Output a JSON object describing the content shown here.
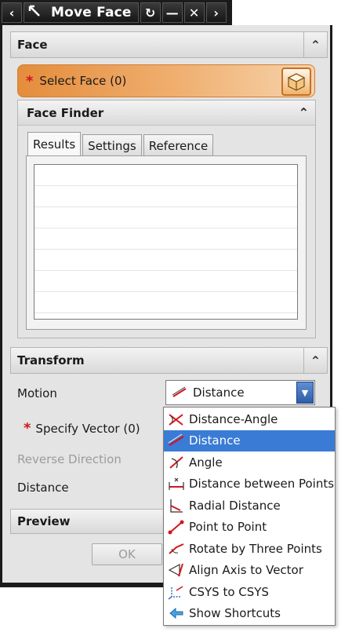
{
  "window": {
    "title": "Move Face"
  },
  "sections": {
    "face": {
      "label": "Face"
    },
    "transform": {
      "label": "Transform"
    },
    "preview": {
      "label": "Preview"
    }
  },
  "select_face": {
    "label": "Select Face (0)",
    "required_mark": "*"
  },
  "face_finder": {
    "label": "Face Finder",
    "tabs": [
      "Results",
      "Settings",
      "Reference"
    ],
    "active_tab": "Results"
  },
  "transform": {
    "motion_label": "Motion",
    "motion_value": "Distance",
    "specify_vector_label": "Specify Vector (0)",
    "required_mark": "*",
    "reverse_direction_label": "Reverse Direction",
    "distance_label": "Distance"
  },
  "motion_options": [
    {
      "label": "Distance-Angle",
      "icon": "distance-angle-icon"
    },
    {
      "label": "Distance",
      "icon": "distance-icon",
      "selected": true
    },
    {
      "label": "Angle",
      "icon": "angle-icon"
    },
    {
      "label": "Distance between Points",
      "icon": "distance-between-points-icon"
    },
    {
      "label": "Radial Distance",
      "icon": "radial-distance-icon"
    },
    {
      "label": "Point to Point",
      "icon": "point-to-point-icon"
    },
    {
      "label": "Rotate by Three Points",
      "icon": "rotate-three-points-icon"
    },
    {
      "label": "Align Axis to Vector",
      "icon": "align-axis-icon"
    },
    {
      "label": "CSYS to CSYS",
      "icon": "csys-icon"
    },
    {
      "label": "Show Shortcuts",
      "icon": "show-shortcuts-icon"
    }
  ],
  "buttons": {
    "ok": "OK"
  },
  "colors": {
    "accent_orange": "#e48d3c",
    "selection_blue": "#3a7bd5",
    "required_red": "#d2161c"
  }
}
